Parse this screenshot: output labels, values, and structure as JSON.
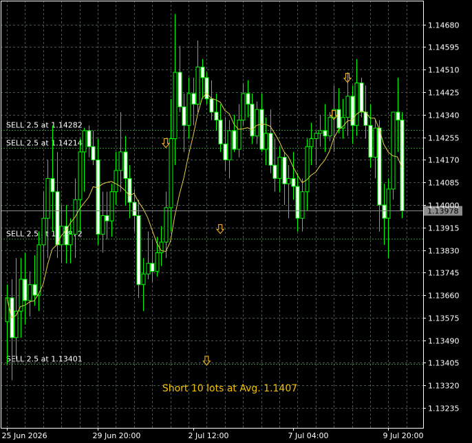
{
  "chart_data": {
    "type": "candlestick",
    "y_ticks": [
      "1.14680",
      "1.14595",
      "1.14510",
      "1.14425",
      "1.14340",
      "1.14255",
      "1.14170",
      "1.14085",
      "1.14000",
      "1.13915",
      "1.13830",
      "1.13745",
      "1.13660",
      "1.13575",
      "1.13490",
      "1.13405",
      "1.13320",
      "1.13235"
    ],
    "ylim": [
      1.1316,
      1.1477
    ],
    "x_ticks": [
      {
        "label": "25 Jun 2026",
        "bar": 0
      },
      {
        "label": "29 Jun 20:00",
        "bar": 20
      },
      {
        "label": "2 Jul 12:00",
        "bar": 41
      },
      {
        "label": "7 Jul 04:00",
        "bar": 63
      },
      {
        "label": "9 Jul 20:00",
        "bar": 84
      }
    ],
    "grid": true,
    "current_price": "1.13978",
    "orders": [
      {
        "label": "SELL 2.5 at 1.14282",
        "price": 1.14282
      },
      {
        "label": "SELL 2.5 at 1.14214",
        "price": 1.14214
      },
      {
        "label": "SELL 2.5 at 1.13872",
        "price": 1.13872
      },
      {
        "label": "SELL 2.5 at 1.13401",
        "price": 1.13401
      }
    ],
    "arrows": [
      {
        "bar": 35,
        "price": 1.14232
      },
      {
        "bar": 47,
        "price": 1.13908
      },
      {
        "bar": 44,
        "price": 1.13412
      },
      {
        "bar": 72,
        "price": 1.14338
      },
      {
        "bar": 75,
        "price": 1.14478
      }
    ],
    "summary": "Short 10 lots at Avg. 1.1407",
    "colors": {
      "background": "#000000",
      "bull_body": "#000000",
      "bear_body": "#ffffff",
      "wick": "#00ff00",
      "grid": "#4a5a4a",
      "order_line": "#2e8b2e",
      "ma_line": "#e6cf4a",
      "arrow": "#e6a820",
      "current_price_line": "#8c8c8c",
      "summary_text": "#f2c200"
    },
    "ohlc": [
      [
        1.1356,
        1.137,
        1.134,
        1.1365
      ],
      [
        1.1365,
        1.1372,
        1.1334,
        1.135
      ],
      [
        1.135,
        1.138,
        1.1342,
        1.136
      ],
      [
        1.136,
        1.138,
        1.135,
        1.1372
      ],
      [
        1.1372,
        1.1382,
        1.1355,
        1.1364
      ],
      [
        1.1364,
        1.1375,
        1.1358,
        1.137
      ],
      [
        1.137,
        1.1381,
        1.1362,
        1.1366
      ],
      [
        1.1366,
        1.139,
        1.136,
        1.1385
      ],
      [
        1.1385,
        1.1405,
        1.1375,
        1.1395
      ],
      [
        1.1395,
        1.1417,
        1.138,
        1.141
      ],
      [
        1.141,
        1.143,
        1.139,
        1.1405
      ],
      [
        1.1405,
        1.142,
        1.138,
        1.1385
      ],
      [
        1.1385,
        1.14,
        1.1378,
        1.1392
      ],
      [
        1.1392,
        1.14,
        1.1378,
        1.1385
      ],
      [
        1.1385,
        1.1395,
        1.1378,
        1.1389
      ],
      [
        1.1389,
        1.141,
        1.138,
        1.1402
      ],
      [
        1.1402,
        1.1425,
        1.139,
        1.142
      ],
      [
        1.142,
        1.1429,
        1.1405,
        1.1428
      ],
      [
        1.1428,
        1.143,
        1.1418,
        1.1422
      ],
      [
        1.1422,
        1.1428,
        1.1415,
        1.1417
      ],
      [
        1.1417,
        1.1425,
        1.1385,
        1.1389
      ],
      [
        1.1389,
        1.1405,
        1.1382,
        1.1396
      ],
      [
        1.1396,
        1.1405,
        1.1387,
        1.1394
      ],
      [
        1.1394,
        1.1408,
        1.1388,
        1.1405
      ],
      [
        1.1405,
        1.142,
        1.14,
        1.1413
      ],
      [
        1.1413,
        1.1435,
        1.1405,
        1.142
      ],
      [
        1.142,
        1.1426,
        1.14,
        1.141
      ],
      [
        1.141,
        1.1415,
        1.1395,
        1.1401
      ],
      [
        1.1401,
        1.1406,
        1.139,
        1.1396
      ],
      [
        1.1396,
        1.1402,
        1.1365,
        1.137
      ],
      [
        1.137,
        1.138,
        1.136,
        1.1374
      ],
      [
        1.1374,
        1.139,
        1.1372,
        1.1378
      ],
      [
        1.1378,
        1.1387,
        1.1371,
        1.1375
      ],
      [
        1.1375,
        1.1388,
        1.1373,
        1.1382
      ],
      [
        1.1382,
        1.1392,
        1.1377,
        1.1386
      ],
      [
        1.1386,
        1.1405,
        1.138,
        1.1399
      ],
      [
        1.1399,
        1.144,
        1.139,
        1.1425
      ],
      [
        1.1425,
        1.1472,
        1.1415,
        1.145
      ],
      [
        1.145,
        1.146,
        1.1435,
        1.1437
      ],
      [
        1.1437,
        1.1442,
        1.142,
        1.143
      ],
      [
        1.143,
        1.1448,
        1.1425,
        1.1442
      ],
      [
        1.1442,
        1.1448,
        1.143,
        1.1438
      ],
      [
        1.1438,
        1.1462,
        1.1435,
        1.1452
      ],
      [
        1.1452,
        1.1455,
        1.144,
        1.1448
      ],
      [
        1.1448,
        1.145,
        1.1438,
        1.144
      ],
      [
        1.144,
        1.1447,
        1.1432,
        1.1435
      ],
      [
        1.1435,
        1.1442,
        1.1428,
        1.1432
      ],
      [
        1.1432,
        1.1438,
        1.142,
        1.1423
      ],
      [
        1.1423,
        1.1433,
        1.1413,
        1.1417
      ],
      [
        1.1417,
        1.1432,
        1.141,
        1.1428
      ],
      [
        1.1428,
        1.1434,
        1.142,
        1.1421
      ],
      [
        1.1421,
        1.1438,
        1.1418,
        1.1432
      ],
      [
        1.1432,
        1.1446,
        1.143,
        1.1442
      ],
      [
        1.1442,
        1.1447,
        1.1433,
        1.1438
      ],
      [
        1.1438,
        1.1442,
        1.1423,
        1.1426
      ],
      [
        1.1426,
        1.1439,
        1.1423,
        1.1436
      ],
      [
        1.1436,
        1.1442,
        1.142,
        1.1421
      ],
      [
        1.1421,
        1.1433,
        1.1415,
        1.1427
      ],
      [
        1.1427,
        1.1436,
        1.1412,
        1.1415
      ],
      [
        1.1415,
        1.1425,
        1.1405,
        1.141
      ],
      [
        1.141,
        1.1422,
        1.1405,
        1.1418
      ],
      [
        1.1418,
        1.142,
        1.14,
        1.1408
      ],
      [
        1.1408,
        1.1415,
        1.1395,
        1.141
      ],
      [
        1.141,
        1.142,
        1.1402,
        1.1407
      ],
      [
        1.1407,
        1.1412,
        1.139,
        1.1395
      ],
      [
        1.1395,
        1.141,
        1.139,
        1.1405
      ],
      [
        1.1405,
        1.1425,
        1.1398,
        1.1422
      ],
      [
        1.1422,
        1.1431,
        1.1415,
        1.1425
      ],
      [
        1.1425,
        1.1428,
        1.1415,
        1.1427
      ],
      [
        1.1427,
        1.1434,
        1.1422,
        1.1428
      ],
      [
        1.1428,
        1.1438,
        1.142,
        1.1426
      ],
      [
        1.1426,
        1.1435,
        1.1424,
        1.1433
      ],
      [
        1.1433,
        1.1445,
        1.142,
        1.1436
      ],
      [
        1.1436,
        1.1444,
        1.1427,
        1.1429
      ],
      [
        1.1429,
        1.144,
        1.1425,
        1.1433
      ],
      [
        1.1433,
        1.145,
        1.1426,
        1.1441
      ],
      [
        1.1441,
        1.1445,
        1.1423,
        1.143
      ],
      [
        1.143,
        1.1455,
        1.1426,
        1.1446
      ],
      [
        1.1446,
        1.1448,
        1.1433,
        1.1435
      ],
      [
        1.1435,
        1.1445,
        1.1425,
        1.143
      ],
      [
        1.143,
        1.1438,
        1.1414,
        1.1418
      ],
      [
        1.1418,
        1.1432,
        1.141,
        1.1429
      ],
      [
        1.1429,
        1.1432,
        1.139,
        1.14
      ],
      [
        1.14,
        1.1408,
        1.1385,
        1.1395
      ],
      [
        1.1395,
        1.141,
        1.138,
        1.1406
      ],
      [
        1.1406,
        1.143,
        1.1402,
        1.1435
      ],
      [
        1.1435,
        1.1448,
        1.142,
        1.1432
      ],
      [
        1.1432,
        1.1435,
        1.1395,
        1.13978
      ]
    ]
  }
}
